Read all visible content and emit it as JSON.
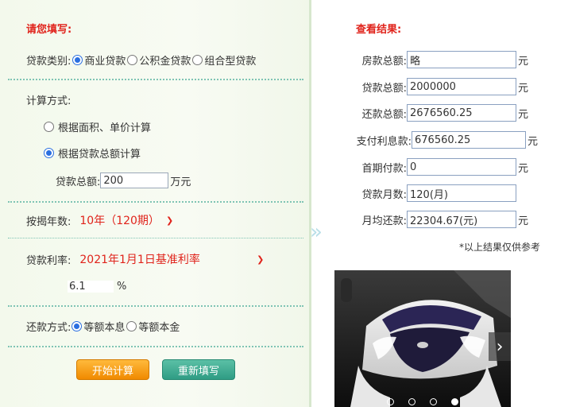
{
  "left": {
    "title": "请您填写:",
    "loan_type": {
      "label": "贷款类别:",
      "options": [
        "商业贷款",
        "公积金贷款",
        "组合型贷款"
      ],
      "selected": "商业贷款"
    },
    "calc_method": {
      "label": "计算方式:",
      "option_area": "根据面积、单价计算",
      "option_total": "根据贷款总额计算",
      "selected": "根据贷款总额计算",
      "loan_total_label": "贷款总额:",
      "loan_total_value": "200",
      "loan_total_unit": "万元"
    },
    "years": {
      "label": "按揭年数:",
      "value": "10年（120期）"
    },
    "rate": {
      "label": "贷款利率:",
      "value": "2021年1月1日基准利率",
      "rate_value": "6.1",
      "unit": "%"
    },
    "repayment": {
      "label": "还款方式:",
      "options": [
        "等额本息",
        "等额本金"
      ],
      "selected": "等额本息"
    },
    "buttons": {
      "calculate": "开始计算",
      "reset": "重新填写"
    }
  },
  "right": {
    "title": "查看结果:",
    "rows": [
      {
        "label": "房款总额:",
        "value": "略",
        "unit": "元"
      },
      {
        "label": "贷款总额:",
        "value": "2000000",
        "unit": "元"
      },
      {
        "label": "还款总额:",
        "value": "2676560.25",
        "unit": "元"
      },
      {
        "label": "支付利息款:",
        "value": "676560.25",
        "unit": "元"
      },
      {
        "label": "首期付款:",
        "value": "0",
        "unit": "元"
      },
      {
        "label": "贷款月数:",
        "value": "120(月)",
        "unit": ""
      },
      {
        "label": "月均还款:",
        "value": "22304.67(元)",
        "unit": "元"
      }
    ],
    "note": "*以上结果仅供参考"
  },
  "carousel": {
    "slide_count": 4,
    "active_index": 3
  },
  "colors": {
    "accent_red": "#e0231b",
    "radio_blue": "#2a6fe0",
    "btn_orange": "#f08a00",
    "btn_teal": "#2f9c84"
  }
}
